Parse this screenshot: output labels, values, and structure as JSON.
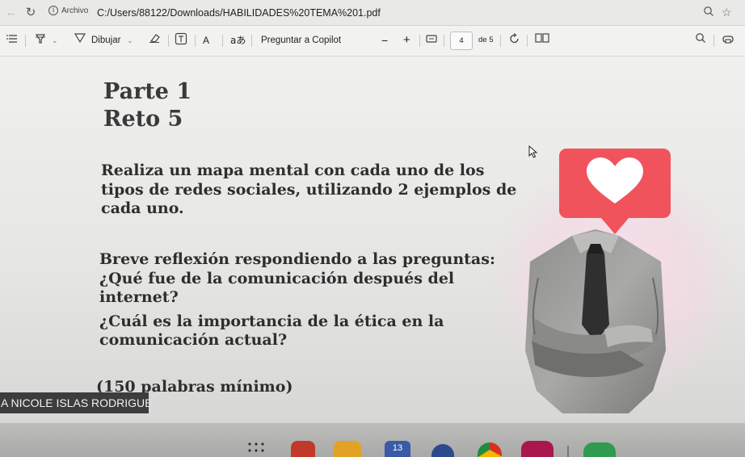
{
  "browser": {
    "info_label": "Archivo",
    "url": "C:/Users/88122/Downloads/HABILIDADES%20TEMA%201.pdf",
    "icons": [
      "back-icon",
      "refresh-icon",
      "info-icon",
      "search-icon",
      "star-icon"
    ]
  },
  "toolbar": {
    "draw_label": "Dibujar",
    "read_aloud_label": "aあ",
    "copilot_label": "Preguntar a Copilot",
    "text_size_label": "A",
    "minus_label": "−",
    "plus_label": "+",
    "page_current": "4",
    "page_total_label": "de 5"
  },
  "slide": {
    "part_title": "Parte 1",
    "reto_title": "Reto 5",
    "instruction_lines": [
      "Realiza un mapa mental con cada uno de los",
      "tipos de redes sociales, utilizando 2 ejemplos de",
      "cada uno."
    ],
    "reflection_lines": [
      "Breve reflexión respondiendo a las preguntas:",
      "¿Qué fue de la comunicación después del",
      "internet?",
      "¿Cuál es la importancia de la ética en la",
      "comunicación actual?"
    ],
    "word_count_note": "(150 palabras mínimo)",
    "student_name": "A NICOLE ISLAS RODRIGUEZ"
  },
  "taskbar": {
    "calendar_date": "13"
  },
  "colors": {
    "heart_bubble": "#f1535d",
    "banner": "#3d3d3d",
    "slide_text": "#2e2e2e"
  }
}
